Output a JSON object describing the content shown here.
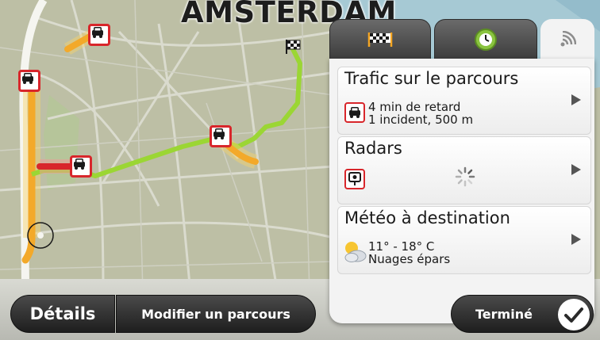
{
  "map": {
    "city_label": "AMSTERDAM",
    "colors": {
      "route": "#9bd634",
      "traffic_slow": "#f3a92a",
      "traffic_jam": "#d8262b",
      "water": "#a6c9d4",
      "land": "#bdbfa5"
    },
    "markers": [
      "traffic-car-icon",
      "traffic-car-icon",
      "traffic-car-icon",
      "traffic-car-icon",
      "destination-flag-icon",
      "current-position-icon"
    ]
  },
  "panel": {
    "tabs": [
      {
        "name": "destination-flag-icon",
        "active": false
      },
      {
        "name": "clock-arrow-icon",
        "active": false
      },
      {
        "name": "signal-waves-icon",
        "active": true
      }
    ],
    "traffic": {
      "title": "Trafic sur le parcours",
      "line1": "4 min de retard",
      "line2": "1 incident, 500 m"
    },
    "speedcams": {
      "title": "Radars"
    },
    "weather": {
      "title": "Météo à destination",
      "line1": "11° - 18° C",
      "line2": "Nuages épars"
    }
  },
  "bottom_bar": {
    "details_label": "Détails",
    "modify_label": "Modifier un parcours",
    "done_label": "Terminé"
  }
}
